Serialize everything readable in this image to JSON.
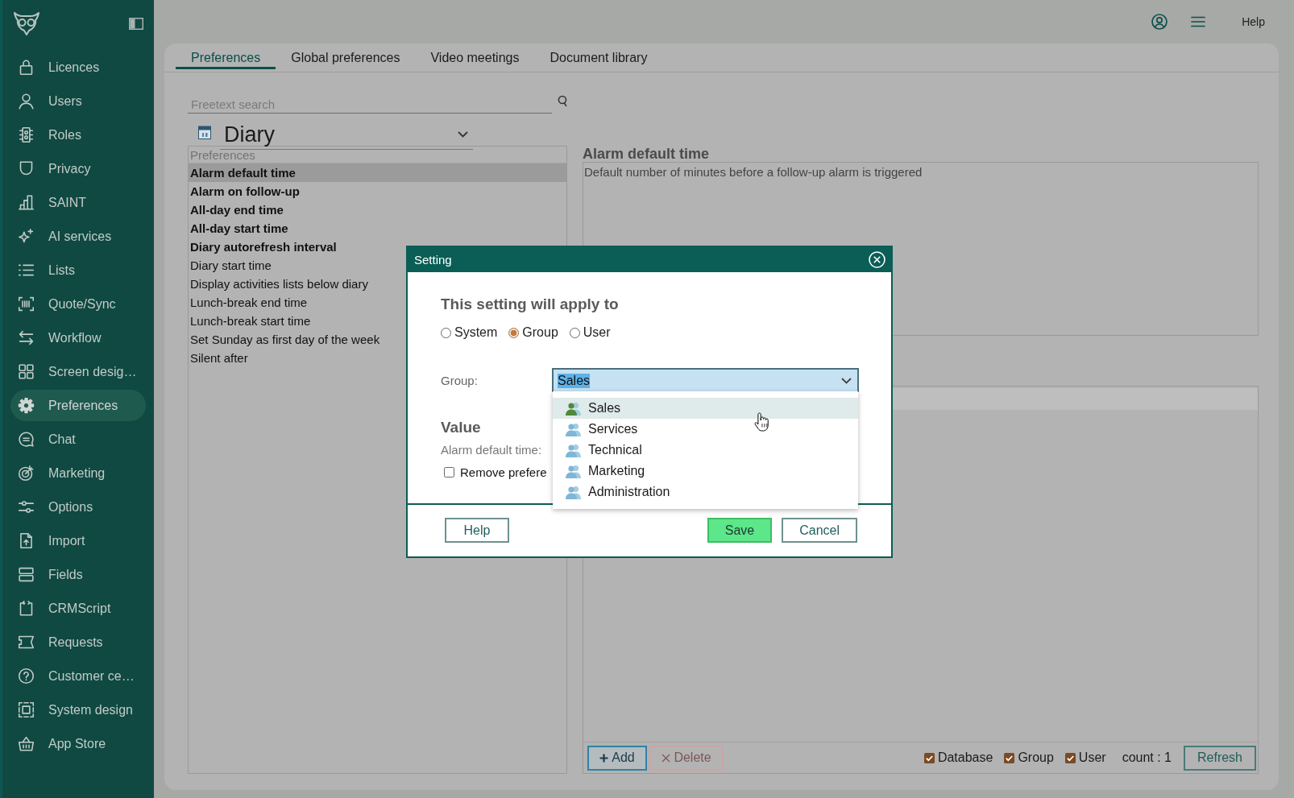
{
  "sidebar": {
    "items": [
      {
        "label": "Licences",
        "selected": false
      },
      {
        "label": "Users",
        "selected": false
      },
      {
        "label": "Roles",
        "selected": false
      },
      {
        "label": "Privacy",
        "selected": false
      },
      {
        "label": "SAINT",
        "selected": false
      },
      {
        "label": "AI services",
        "selected": false
      },
      {
        "label": "Lists",
        "selected": false
      },
      {
        "label": "Quote/Sync",
        "selected": false
      },
      {
        "label": "Workflow",
        "selected": false
      },
      {
        "label": "Screen desig…",
        "selected": false
      },
      {
        "label": "Preferences",
        "selected": true
      },
      {
        "label": "Chat",
        "selected": false
      },
      {
        "label": "Marketing",
        "selected": false
      },
      {
        "label": "Options",
        "selected": false
      },
      {
        "label": "Import",
        "selected": false
      },
      {
        "label": "Fields",
        "selected": false
      },
      {
        "label": "CRMScript",
        "selected": false
      },
      {
        "label": "Requests",
        "selected": false
      },
      {
        "label": "Customer ce…",
        "selected": false
      },
      {
        "label": "System design",
        "selected": false
      },
      {
        "label": "App Store",
        "selected": false
      }
    ]
  },
  "top_bar": {
    "help": "Help"
  },
  "tabs": [
    {
      "label": "Preferences",
      "selected": true
    },
    {
      "label": "Global preferences",
      "selected": false
    },
    {
      "label": "Video meetings",
      "selected": false
    },
    {
      "label": "Document library",
      "selected": false
    }
  ],
  "search": {
    "placeholder": "Freetext search"
  },
  "category_select": {
    "value": "Diary"
  },
  "preferences_list": {
    "header": "Preferences",
    "items": [
      {
        "label": "Alarm default time",
        "bold": true,
        "selected": true
      },
      {
        "label": "Alarm on follow-up",
        "bold": true,
        "selected": false
      },
      {
        "label": "All-day end time",
        "bold": true,
        "selected": false
      },
      {
        "label": "All-day start time",
        "bold": true,
        "selected": false
      },
      {
        "label": "Diary autorefresh interval",
        "bold": true,
        "selected": false
      },
      {
        "label": "Diary start time",
        "bold": false,
        "selected": false
      },
      {
        "label": "Display activities lists below diary",
        "bold": false,
        "selected": false
      },
      {
        "label": "Lunch-break end time",
        "bold": false,
        "selected": false
      },
      {
        "label": "Lunch-break start time",
        "bold": false,
        "selected": false
      },
      {
        "label": "Set Sunday as first day of the week",
        "bold": false,
        "selected": false
      },
      {
        "label": "Silent after",
        "bold": false,
        "selected": false
      }
    ]
  },
  "detail": {
    "title": "Alarm default time",
    "description": "Default number of minutes before a follow-up alarm is triggered"
  },
  "settings_table": {
    "buttons": [
      {
        "label": "Add",
        "kind": "add",
        "disabled": false
      },
      {
        "label": "Delete",
        "kind": "delete",
        "disabled": true
      }
    ],
    "filters": [
      {
        "label": "Database",
        "checked": true
      },
      {
        "label": "Group",
        "checked": true
      },
      {
        "label": "User",
        "checked": true
      }
    ],
    "count": "count : 1",
    "refresh": "Refresh"
  },
  "dialog": {
    "title": "Setting",
    "apply_heading": "This setting will apply to",
    "scope_options": [
      {
        "label": "System",
        "selected": false
      },
      {
        "label": "Group",
        "selected": true
      },
      {
        "label": "User",
        "selected": false
      }
    ],
    "group_label": "Group:",
    "group_select": {
      "value": "Sales",
      "text_highlighted": true,
      "expanded": true,
      "options": [
        {
          "label": "Sales",
          "selected": true
        },
        {
          "label": "Services",
          "selected": false
        },
        {
          "label": "Technical",
          "selected": false
        },
        {
          "label": "Marketing",
          "selected": false
        },
        {
          "label": "Administration",
          "selected": false
        }
      ]
    },
    "value_heading": "Value",
    "value_label": "Alarm default time:",
    "remove_checkbox": {
      "label": "Remove prefere",
      "checked": false
    },
    "footer": {
      "left": [
        {
          "label": "Help",
          "kind": "secondary"
        }
      ],
      "right": [
        {
          "label": "Save",
          "kind": "primary"
        },
        {
          "label": "Cancel",
          "kind": "secondary"
        }
      ]
    }
  }
}
